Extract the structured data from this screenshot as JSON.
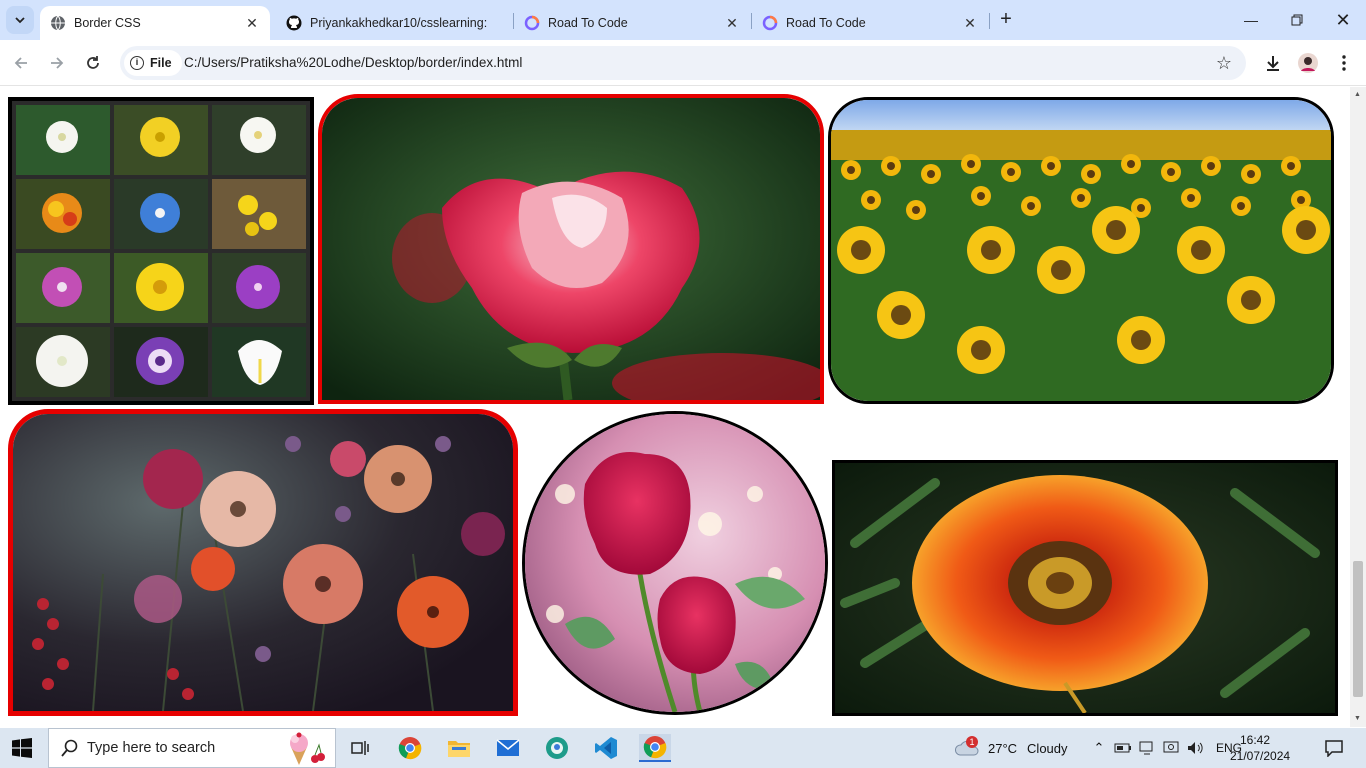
{
  "browser": {
    "tabs": [
      {
        "label": "Border CSS",
        "active": true,
        "icon": "globe-icon"
      },
      {
        "label": "Priyankakhedkar10/csslearning:",
        "active": false,
        "icon": "github-icon"
      },
      {
        "label": "Road To Code",
        "active": false,
        "icon": "roadtocode-icon"
      },
      {
        "label": "Road To Code",
        "active": false,
        "icon": "roadtocode-icon"
      }
    ],
    "address": {
      "scheme_label": "File",
      "url": "C:/Users/Pratiksha%20Lodhe/Desktop/border/index.html"
    }
  },
  "page": {
    "images": [
      {
        "subject": "flower-species-grid",
        "border_color": "#000000"
      },
      {
        "subject": "red-white-rose",
        "border_color": "#e60000"
      },
      {
        "subject": "sunflower-field",
        "border_color": "#000000"
      },
      {
        "subject": "assorted-flowers-dark",
        "border_color": "#e60000"
      },
      {
        "subject": "two-red-roses",
        "border_color": "#000000"
      },
      {
        "subject": "orange-gazania",
        "border_color": "#000000"
      }
    ]
  },
  "taskbar": {
    "search_placeholder": "Type here to search",
    "weather_temp": "27°C",
    "weather_desc": "Cloudy",
    "weather_badge": "1",
    "language": "ENG",
    "time": "16:42",
    "date": "21/07/2024"
  }
}
